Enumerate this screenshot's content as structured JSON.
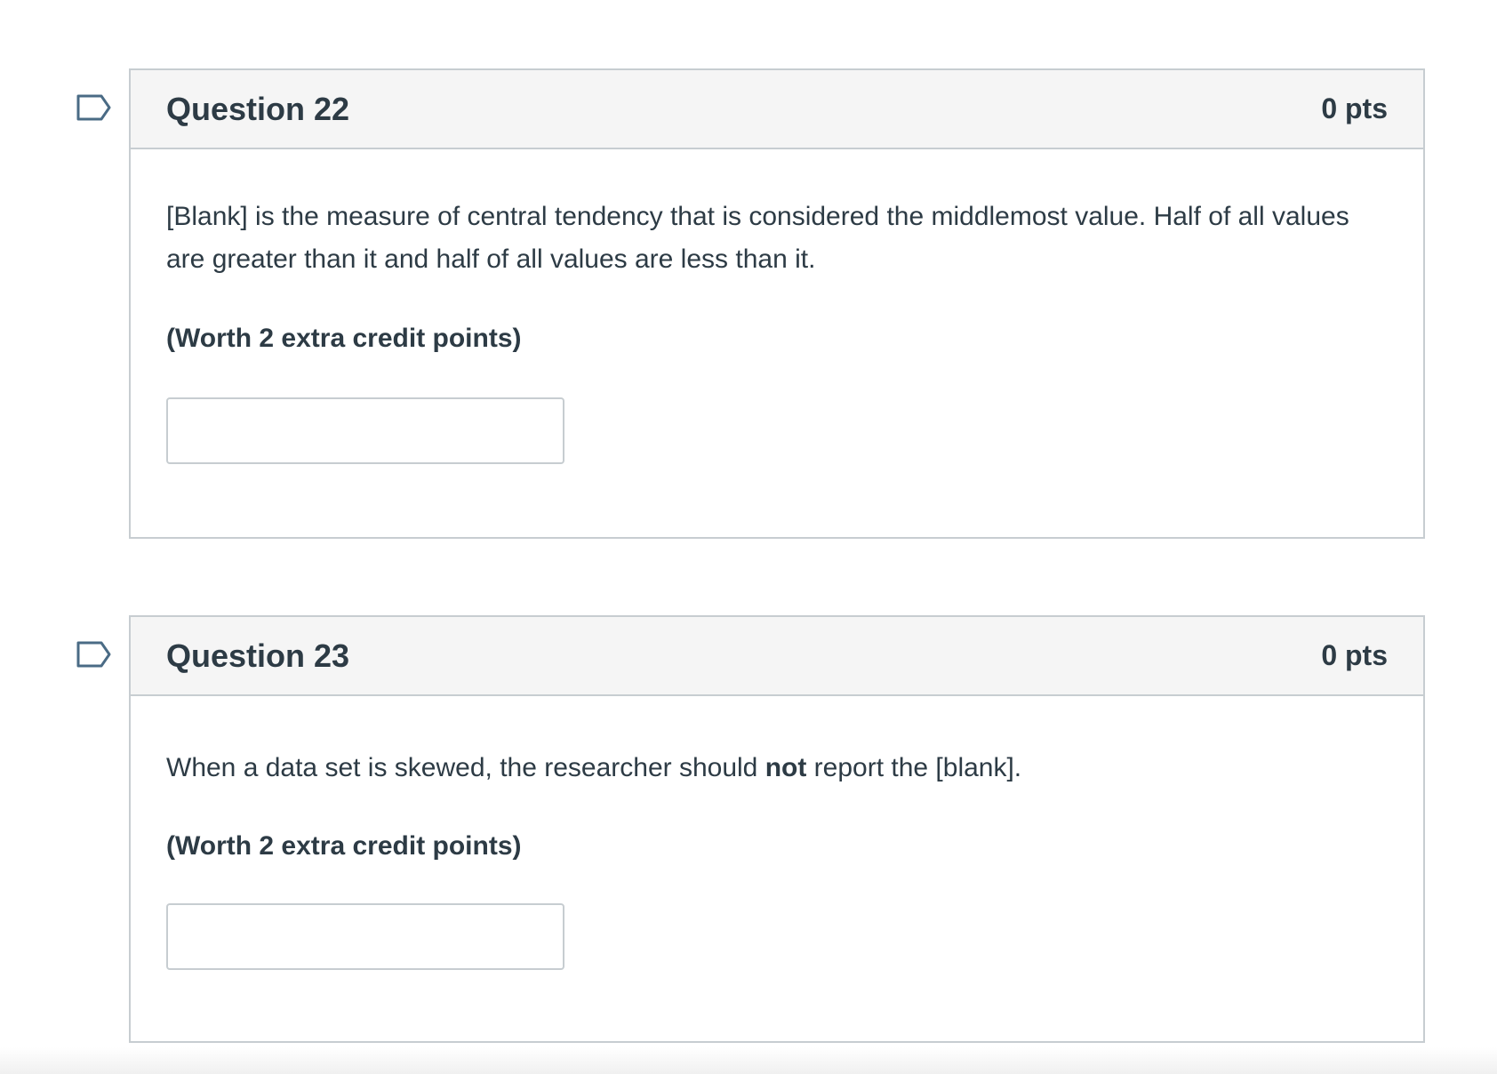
{
  "questions": [
    {
      "title": "Question 22",
      "points": "0 pts",
      "text": "[Blank] is the measure of central tendency that is considered the middlemost value. Half of all values are greater than it and half of all values are less than it.",
      "note": "(Worth 2 extra credit points)",
      "answer_value": ""
    },
    {
      "title": "Question 23",
      "points": "0 pts",
      "text_before": "When a data set is skewed, the researcher should ",
      "text_bold": "not",
      "text_after": " report the [blank].",
      "note": "(Worth 2 extra credit points)",
      "answer_value": ""
    }
  ],
  "icons": {
    "flag": "flag-question-icon"
  },
  "colors": {
    "text": "#2d3b45",
    "border": "#c7cdd1",
    "header_bg": "#f5f5f5",
    "flag_stroke": "#4a6b85"
  }
}
